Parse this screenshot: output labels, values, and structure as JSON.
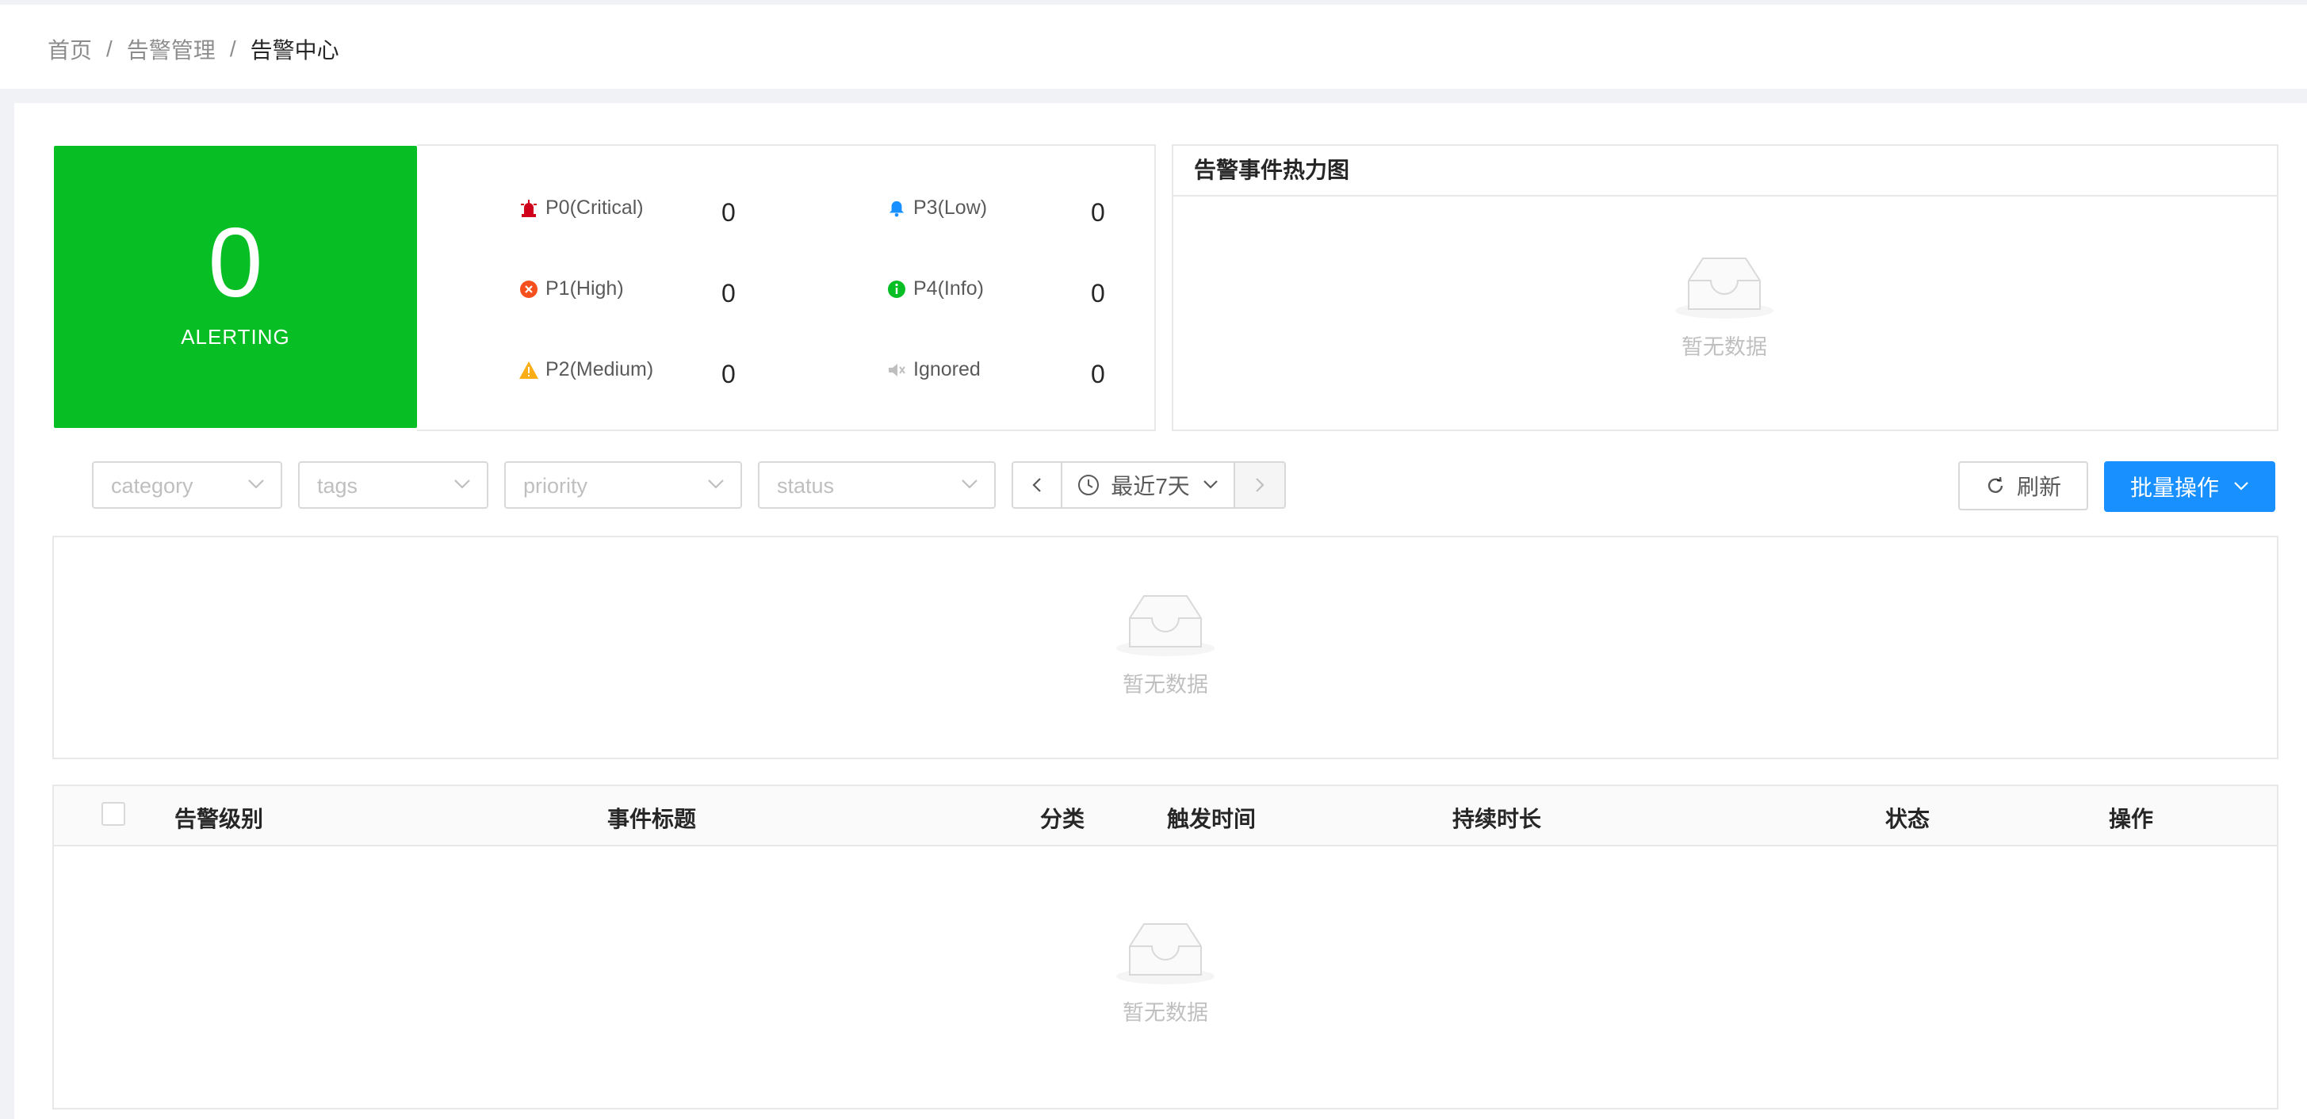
{
  "breadcrumb": {
    "home": "首页",
    "parent": "告警管理",
    "current": "告警中心",
    "separator": "/"
  },
  "summary": {
    "count": "0",
    "label": "ALERTING",
    "color": "#07bf25"
  },
  "stats": [
    {
      "icon": "siren-icon",
      "label": "P0(Critical)",
      "value": "0",
      "color": "#d0021b"
    },
    {
      "icon": "bell-icon",
      "label": "P3(Low)",
      "value": "0",
      "color": "#1890ff"
    },
    {
      "icon": "close-circle-icon",
      "label": "P1(High)",
      "value": "0",
      "color": "#f5501e"
    },
    {
      "icon": "info-circle-icon",
      "label": "P4(Info)",
      "value": "0",
      "color": "#07bf25"
    },
    {
      "icon": "warning-icon",
      "label": "P2(Medium)",
      "value": "0",
      "color": "#faad14"
    },
    {
      "icon": "mute-icon",
      "label": "Ignored",
      "value": "0",
      "color": "#bfbfbf"
    }
  ],
  "heatmap": {
    "title": "告警事件热力图",
    "empty_text": "暂无数据"
  },
  "filters": {
    "category_placeholder": "category",
    "tags_placeholder": "tags",
    "priority_placeholder": "priority",
    "status_placeholder": "status",
    "date_range": "最近7天"
  },
  "actions": {
    "refresh_label": "刷新",
    "batch_label": "批量操作",
    "primary_color": "#1890ff"
  },
  "chart": {
    "empty_text": "暂无数据"
  },
  "table": {
    "columns": [
      "告警级别",
      "事件标题",
      "分类",
      "触发时间",
      "持续时长",
      "状态",
      "操作"
    ],
    "rows": [],
    "empty_text": "暂无数据"
  }
}
